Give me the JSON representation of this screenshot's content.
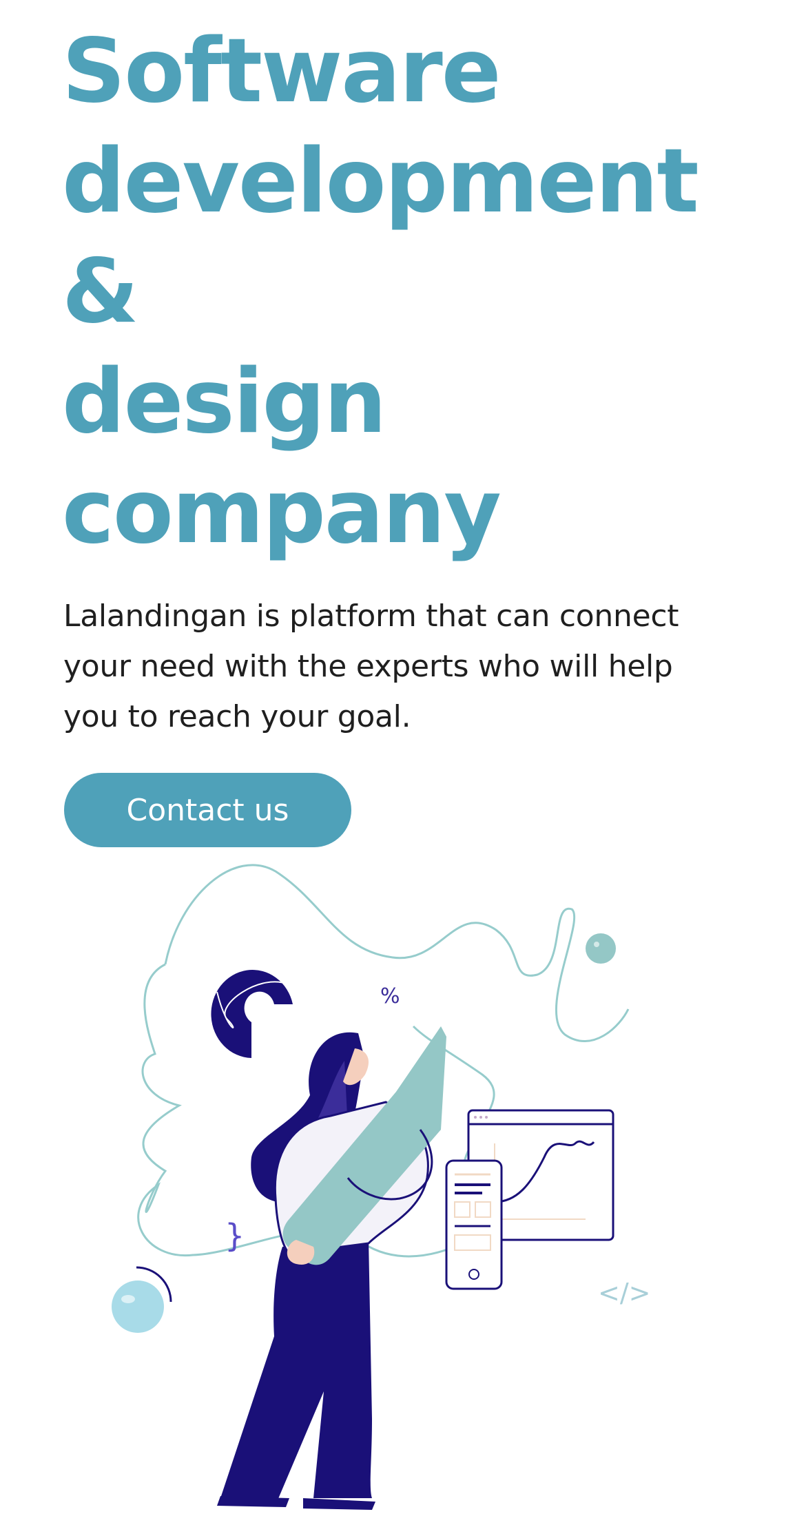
{
  "hero": {
    "title_lines": [
      "Software",
      "development",
      "&",
      "design",
      "company"
    ],
    "description": "Lalandingan is platform that can connect your need with the experts who will help you to reach your goal.",
    "cta_label": "Contact us"
  },
  "illustration": {
    "percent_symbol": "%",
    "brace_symbol": "}",
    "code_symbol": "</>"
  },
  "colors": {
    "brand": "#4fa1b9",
    "text": "#1f1f1f",
    "navy": "#1a1078",
    "purple": "#3b2d9a",
    "mint": "#94c7c6",
    "light_blue": "#a8dbe8",
    "teal_outline": "#96cccc"
  }
}
